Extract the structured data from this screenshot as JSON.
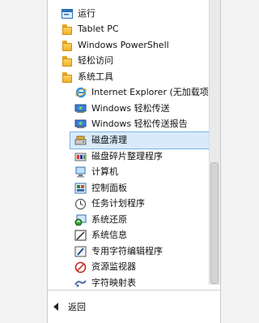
{
  "menu": {
    "items": [
      {
        "label": "运行",
        "icon": "run-icon",
        "level": 0
      },
      {
        "label": "Tablet PC",
        "icon": "folder-icon",
        "level": 0
      },
      {
        "label": "Windows PowerShell",
        "icon": "folder-icon",
        "level": 0
      },
      {
        "label": "轻松访问",
        "icon": "folder-icon",
        "level": 0
      },
      {
        "label": "系统工具",
        "icon": "folder-icon",
        "level": 0
      },
      {
        "label": "Internet Explorer (无加载项)",
        "icon": "internet-explorer-icon",
        "level": 1
      },
      {
        "label": "Windows 轻松传送",
        "icon": "easy-transfer-icon",
        "level": 1
      },
      {
        "label": "Windows 轻松传送报告",
        "icon": "easy-transfer-report-icon",
        "level": 1
      },
      {
        "label": "磁盘清理",
        "icon": "disk-cleanup-icon",
        "level": 1,
        "selected": true
      },
      {
        "label": "磁盘碎片整理程序",
        "icon": "defragmenter-icon",
        "level": 1
      },
      {
        "label": "计算机",
        "icon": "computer-icon",
        "level": 1
      },
      {
        "label": "控制面板",
        "icon": "control-panel-icon",
        "level": 1
      },
      {
        "label": "任务计划程序",
        "icon": "task-scheduler-icon",
        "level": 1
      },
      {
        "label": "系统还原",
        "icon": "system-restore-icon",
        "level": 1
      },
      {
        "label": "系统信息",
        "icon": "system-info-icon",
        "level": 1
      },
      {
        "label": "专用字符编辑程序",
        "icon": "char-editor-icon",
        "level": 1
      },
      {
        "label": "资源监视器",
        "icon": "resource-monitor-icon",
        "level": 1
      },
      {
        "label": "字符映射表",
        "icon": "character-map-icon",
        "level": 1
      }
    ],
    "back_label": "返回"
  },
  "colors": {
    "selection_bg": "#d9ebfb",
    "selection_border": "#7fb3e6"
  }
}
